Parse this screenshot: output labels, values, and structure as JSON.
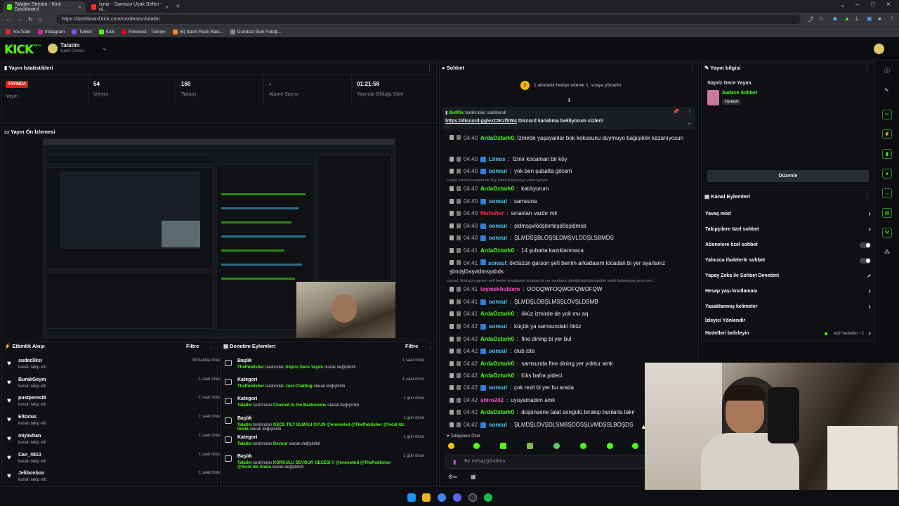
{
  "browser": {
    "tabs": [
      {
        "label": "Talatim Stream - Kick Dashboard",
        "active": true
      },
      {
        "label": "İzmir - Samsun Uçak Seferi - ol...",
        "active": false
      }
    ],
    "url": "https://dashboard.kick.com/moderator/talatim",
    "bookmarks": [
      "YouTube",
      "Instagram",
      "Twitch",
      "Kick",
      "Pinterest - Türkiye",
      "(6) Sport Rock Raci...",
      "Ücretsiz Stok Fotoğ..."
    ]
  },
  "header": {
    "logo": "KICK",
    "beta": "BETA",
    "channel_name": "Talatim",
    "channel_role": "İçerik Üretici"
  },
  "stats": {
    "title": "Yayın İstatistikleri",
    "live_badge": "YAYINDA",
    "live_label": "Yayın",
    "viewers_value": "54",
    "viewers_label": "İzleyici",
    "followers_value": "160",
    "followers_label": "Takipçi",
    "subs_value": "-",
    "subs_label": "Abone Sayısı",
    "uptime_value": "01:21:56",
    "uptime_label": "Yayında Olduğu Süre"
  },
  "preview": {
    "title": "Yayın Ön İzlemesi"
  },
  "activity": {
    "title": "Etkinlik Akışı",
    "filter": "Filtre",
    "items": [
      {
        "name": "sudecliksi",
        "action": "kanalı takip etti",
        "time": "39 dakika önce"
      },
      {
        "name": "BurakGeym",
        "action": "kanalı takip etti",
        "time": "1 saat önce"
      },
      {
        "name": "pustperest8",
        "action": "kanalı takip etti",
        "time": "1 saat önce"
      },
      {
        "name": "Eltorius",
        "action": "kanalı takip etti",
        "time": "1 saat önce"
      },
      {
        "name": "miyavhan",
        "action": "kanalı takip etti",
        "time": "1 saat önce"
      },
      {
        "name": "Can_4810",
        "action": "kanalı takip etti",
        "time": "1 saat önce"
      },
      {
        "name": "Jelibonbon",
        "action": "kanalı takip etti",
        "time": "1 saat önce"
      }
    ]
  },
  "moderation": {
    "title": "Denetim Eylemleri",
    "filter": "Filtre",
    "items": [
      {
        "type": "Başlık",
        "user": "ThePublisher",
        "mid": " tarafından ",
        "value": "Süpriz Gece Yayını",
        "tail": " olarak değiştirildi",
        "time": "1 saat önce"
      },
      {
        "type": "Kategori",
        "user": "ThePublisher",
        "mid": " tarafından ",
        "value": "Just Chatting",
        "tail": " olarak değiştirildi",
        "time": "1 saat önce"
      },
      {
        "type": "Kategori",
        "user": "Talatim",
        "mid": " tarafından ",
        "value": "Chained in the Backrooms",
        "tail": " olarak değiştirildi",
        "time": "1 gün önce"
      },
      {
        "type": "Başlık",
        "user": "Talatim",
        "mid": " tarafından ",
        "value": "GECE TİLT OLMALI OYUN @eneswind @ThePublisher @focid ldc linsta",
        "tail": " olarak değiştirildi",
        "time": "1 gün önce"
      },
      {
        "type": "Kategori",
        "user": "Talatim",
        "mid": " tarafından ",
        "value": "Devour",
        "tail": " olarak değiştirildi",
        "time": "1 gün önce"
      },
      {
        "type": "Başlık",
        "user": "Talatim",
        "mid": " tarafından ",
        "value": "KORKULU DEVOUR GECESİ !! @eneswind @ThePublisher @focid ldc linsta",
        "tail": " olarak değiştirildi",
        "time": "1 gün önce"
      }
    ]
  },
  "chat": {
    "title": "Sohbet",
    "gift_banner": "1 abonelik hediye ederek 1. sıraya yükselin",
    "gift_rank": "1",
    "pinned_by": "BotRix",
    "pinned_suffix": " tarafından sabitlendi",
    "pinned_link": "https://discord.gg/exCtKzfbW4",
    "pinned_text": " Discord kanalıma bekliyorum sizleri!",
    "reply_note_1": "Limos: İzmir kocaman bir köy isimli kullanıcıya yanıt veriyor",
    "reply_note_2": "sonsul: ököüzün garson şefi benim arkadasım locadan bi yer ayarlanız şlmdşlösşlvldmsşsbds isimli kullanıcıya yanıt veri...",
    "messages": [
      {
        "time": "04:40",
        "user": "ArdaOzturk0",
        "color": "#53fc18",
        "text": "İzmirde yaşayanlar bok kokusunu duymuyo bağışıklık kazanıyosun"
      },
      {
        "time": "04:40",
        "user": "Limos",
        "color": "#53c8fc",
        "text": "İzmir kocaman bir köy"
      },
      {
        "time": "04:40",
        "user": "sonsul",
        "color": "#53c8fc",
        "text": "yok ben şubatta gitcem"
      },
      {
        "time": "04:40",
        "user": "ArdaOzturk0",
        "color": "#53fc18",
        "text": "katılıyorum"
      },
      {
        "time": "04:40",
        "user": "sonsul",
        "color": "#53c8fc",
        "text": "samsuna"
      },
      {
        "time": "04:40",
        "user": "Muhaher",
        "color": "#fc2e53",
        "text": "sınavları vardır mk"
      },
      {
        "time": "04:40",
        "user": "sonsul",
        "color": "#53c8fc",
        "text": "şldmsşvlödşlsmbşdösşldmsb"
      },
      {
        "time": "04:40",
        "user": "sonsul",
        "color": "#53c8fc",
        "text": "ŞLMDSŞBLÖŞSLDMŞVLÖDŞLSBMDS"
      },
      {
        "time": "04:41",
        "user": "ArdaOzturk0",
        "color": "#53fc18",
        "text": "14 şubatta kazıklanmaca"
      },
      {
        "time": "04:41",
        "user": "sonsul",
        "color": "#53c8fc",
        "text": "ököüzün garson şefi benim arkadasım locadan bi yer ayarlanız şlmdşlösşvldmsşsbds"
      },
      {
        "time": "04:41",
        "user": "taymekholdem",
        "color": "#fc53c8",
        "text": "OOOQWFOQWOFQWOFQW"
      },
      {
        "time": "04:41",
        "user": "sonsul",
        "color": "#53c8fc",
        "text": "ŞLMDŞLÖBŞLMSŞLÖVŞLDSMB"
      },
      {
        "time": "04:41",
        "user": "ArdaOzturk0",
        "color": "#53fc18",
        "text": "öküz izmirde de yok mu aq"
      },
      {
        "time": "04:42",
        "user": "sonsul",
        "color": "#53c8fc",
        "text": "küçük ya samsundaki öküz"
      },
      {
        "time": "04:42",
        "user": "ArdaOzturk0",
        "color": "#53fc18",
        "text": "fine dining bi yer bul"
      },
      {
        "time": "04:42",
        "user": "sonsul",
        "color": "#53c8fc",
        "text": "club iste"
      },
      {
        "time": "04:42",
        "user": "ArdaOzturk0",
        "color": "#53fc18",
        "text": "samsunda fine dining yer yoktur amk"
      },
      {
        "time": "04:42",
        "user": "ArdaOzturk0",
        "color": "#53fc18",
        "text": "lüks bafra pideci"
      },
      {
        "time": "04:42",
        "user": "sonsul",
        "color": "#53c8fc",
        "text": "çok rezil bi yer bu arada"
      },
      {
        "time": "04:42",
        "user": "shiro242",
        "color": "#fc53c8",
        "text": "uyuyamadım amk"
      },
      {
        "time": "04:42",
        "user": "ArdaOzturk0",
        "color": "#53fc18",
        "text": "düşünsene talat songülü bırakıp bunlarla takıl"
      },
      {
        "time": "04:42",
        "user": "sonsul",
        "color": "#53c8fc",
        "text": "ŞLMDŞLÖVŞDLSMBŞDÖSŞLVMDŞSLBÖŞDS"
      }
    ],
    "followers_only": "Takipçilere Özel",
    "input_placeholder": "Bir mesaj gönderin"
  },
  "stream_info": {
    "title": "Yayın bilgisi",
    "stream_title": "Süpriz Gece Yayını",
    "category": "Sadece Sohbet",
    "tag": "Turkish",
    "edit_button": "Düzenle"
  },
  "channel_actions": {
    "title": "Kanal Eylemleri",
    "items": [
      {
        "label": "Yavaş mod",
        "kind": "chevron"
      },
      {
        "label": "Takipçilere özel sohbet",
        "kind": "chevron"
      },
      {
        "label": "Abonelere özel sohbet",
        "kind": "toggle"
      },
      {
        "label": "Yalnızca ifadelerle sohbet",
        "kind": "toggle"
      },
      {
        "label": "Yapay Zeka ile Sohbet Denetimi",
        "kind": "external"
      },
      {
        "label": "Hesap yaşı kısıtlaması",
        "kind": "chevron"
      },
      {
        "label": "Yasaklanmış kelimeler",
        "kind": "chevron"
      },
      {
        "label": "İzleyici Yönlendir",
        "kind": "none"
      },
      {
        "label": "Hedefleri belirleyin",
        "kind": "goal"
      }
    ],
    "goal_status": "Aktif hedefler - 2"
  }
}
